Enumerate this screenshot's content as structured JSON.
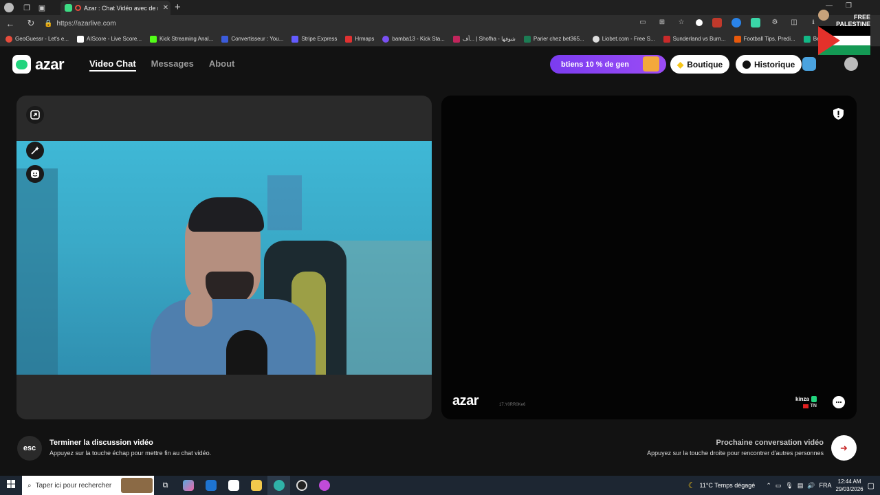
{
  "browser": {
    "tab_title": "Azar : Chat Vidéo avec de n",
    "url": "https://azarlive.com",
    "bookmarks": [
      "GeoGuessr - Let's e...",
      "AIScore - Live Score...",
      "Kick Streaming Anal...",
      "Convertisseur : You...",
      "Stripe Express",
      "Hrmaps",
      "bamba13 - Kick Sta...",
      "أف... | Shofha - شوفها",
      "Parier chez bet365...",
      "Liobet.com - Free S...",
      "Sunderland vs Burn...",
      "Football Tips, Predi...",
      "Bet Th"
    ],
    "flag_text_1": "FREE",
    "flag_text_2": "PALESTINE"
  },
  "app": {
    "logo_text": "azar",
    "nav": [
      "Video Chat",
      "Messages",
      "About"
    ],
    "promo_text": "btiens 10 % de gen",
    "shop_label": "Boutique",
    "history_label": "Historique"
  },
  "video": {
    "watermark": "azar",
    "watermark_id": "17.Y0RR0Ke6",
    "peer_name": "kinza",
    "peer_country": "TN"
  },
  "controls": {
    "esc_label": "esc",
    "end_title": "Terminer la discussion vidéo",
    "end_subtitle": "Appuyez sur la touche échap pour mettre fin au chat vidéo.",
    "next_title": "Prochaine conversation vidéo",
    "next_subtitle": "Appuyez sur la touche droite pour rencontrer d'autres personnes"
  },
  "taskbar": {
    "search_placeholder": "Taper ici pour rechercher",
    "weather": "11°C  Temps dégagé",
    "lang": "FRA",
    "time": "12:44 AM",
    "date": "29/03/2026"
  },
  "colors": {
    "accent_green": "#22d47e",
    "promo_purple": "#7b3cf0",
    "bg": "#121212"
  }
}
